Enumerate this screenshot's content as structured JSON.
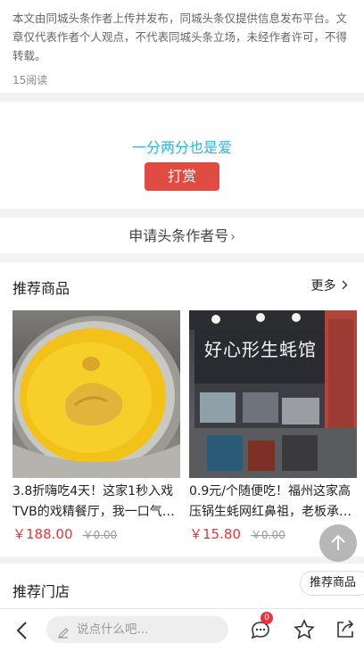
{
  "disclaimer": {
    "text": "本文由同城头条作者上传并发布，同城头条仅提供信息发布平台。文章仅代表作者个人观点，不代表同城头条立场，未经作者许可，不得转载。",
    "reads": "15阅读"
  },
  "reward": {
    "slogan": "一分两分也是爱",
    "button": "打赏"
  },
  "apply": {
    "label": "申请头条作者号",
    "chevron": "›"
  },
  "products": {
    "heading": "推荐商品",
    "more": "更多",
    "items": [
      {
        "title": "3.8折嗨吃4天！这家1秒入戏TVB的戏精餐厅，我一口气…",
        "price": "￥188.00",
        "old_price": "￥0.00"
      },
      {
        "title": "0.9元/个随便吃！福州这家高压锅生蚝网红鼻祖，老板承…",
        "price": "￥15.80",
        "old_price": "￥0.00",
        "sign_text": "好心形生蚝馆"
      }
    ]
  },
  "stores": {
    "heading": "推荐门店"
  },
  "floating": {
    "recommend_pill": "推荐商品"
  },
  "bottombar": {
    "comment_placeholder": "说点什么吧...",
    "comment_badge": "0"
  },
  "colors": {
    "accent_red": "#e04b43",
    "slogan_cyan": "#2ab6cf",
    "price_red": "#e8343c"
  }
}
